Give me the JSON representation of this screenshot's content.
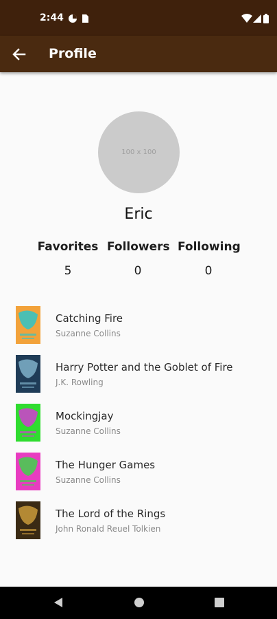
{
  "status_bar": {
    "time": "2:44",
    "icons": [
      "data-saver-icon",
      "sim-card-icon",
      "wifi-icon",
      "signal-icon",
      "battery-icon"
    ]
  },
  "app_bar": {
    "title": "Profile",
    "back_icon": "arrow-back-icon"
  },
  "profile": {
    "avatar_placeholder": "100 x 100",
    "name": "Eric",
    "stats": [
      {
        "label": "Favorites",
        "value": "5"
      },
      {
        "label": "Followers",
        "value": "0"
      },
      {
        "label": "Following",
        "value": "0"
      }
    ]
  },
  "books": [
    {
      "title": "Catching Fire",
      "author": "Suzanne Collins",
      "cover_color": "#f2a23a",
      "cover_accent": "#2ec4c9"
    },
    {
      "title": "Harry Potter and the Goblet of Fire",
      "author": "J.K. Rowling",
      "cover_color": "#1f3c57",
      "cover_accent": "#7fb0c9"
    },
    {
      "title": "Mockingjay",
      "author": "Suzanne Collins",
      "cover_color": "#2fdc2f",
      "cover_accent": "#d23cd2"
    },
    {
      "title": "The Hunger Games",
      "author": "Suzanne Collins",
      "cover_color": "#e83cc0",
      "cover_accent": "#3fd24a"
    },
    {
      "title": "The Lord of the Rings",
      "author": "John Ronald Reuel Tolkien",
      "cover_color": "#3a2a14",
      "cover_accent": "#c99a3a"
    }
  ],
  "nav_bar": {
    "icons": [
      "nav-back-icon",
      "nav-home-icon",
      "nav-recents-icon"
    ]
  },
  "colors": {
    "status_bar": "#3f210c",
    "app_bar": "#4a2a10",
    "background": "#fafafa"
  }
}
